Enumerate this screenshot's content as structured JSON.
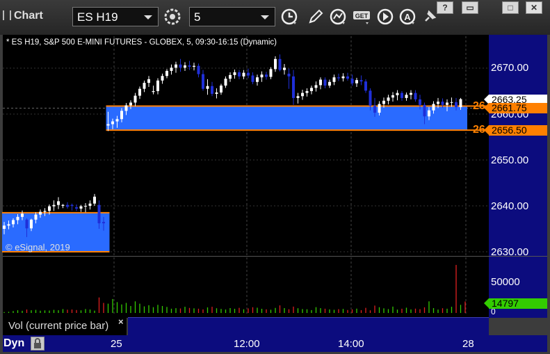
{
  "app": {
    "title": "Chart",
    "symbol": "ES H19",
    "interval": "5",
    "dyn_label": "Dyn"
  },
  "toolbar_icons": [
    "settings-icon",
    "clock-icon",
    "pencil-icon",
    "chart-type-icon",
    "get-icon",
    "play-icon",
    "a-icon",
    "pin-icon"
  ],
  "window_buttons": [
    "?",
    "▭",
    "□",
    "✕"
  ],
  "chart": {
    "description": "* ES H19, S&P 500 E-MINI FUTURES - GLOBEX, 5, 09:30-16:15 (Dynamic)",
    "copyright": "© eSignal, 2019",
    "price_ticks": [
      "2670.00",
      "2660.00",
      "2650.00",
      "2640.00",
      "2630.00"
    ],
    "last_price": "2663.25",
    "high_tag": "2661.75",
    "low_tag": "2656.50",
    "orange_label_1": "26",
    "orange_label_2": "26",
    "time_ticks": [
      "25",
      "12:00",
      "14:00",
      "28"
    ]
  },
  "volume": {
    "legend": "Vol (current price bar)",
    "close": "×",
    "ticks": [
      "50000",
      "0"
    ],
    "last": "14797"
  },
  "colors": {
    "background": "#000000",
    "scale": "#0c0c7e",
    "band": "#2a6bff",
    "orange": "#ff8000",
    "bull": "#ffffff",
    "bear": "#1f2fd8"
  },
  "chart_data": {
    "type": "candlestick",
    "ylim": [
      2628,
      2675
    ],
    "bands": [
      {
        "from_bar": 0,
        "to_bar": 23,
        "high": 2638.5,
        "low": 2630.0
      },
      {
        "from_bar": 23,
        "to_bar": 102,
        "high": 2661.75,
        "low": 2656.5
      }
    ],
    "candles": [
      [
        2635.0,
        2636.5,
        2633.8,
        2635.7
      ],
      [
        2635.7,
        2636.8,
        2634.9,
        2636.0
      ],
      [
        2636.0,
        2637.3,
        2635.3,
        2636.9
      ],
      [
        2636.9,
        2638.2,
        2636.0,
        2637.6
      ],
      [
        2637.6,
        2639.0,
        2636.9,
        2638.3
      ],
      [
        2637.0,
        2637.3,
        2633.2,
        2635.1
      ],
      [
        2635.1,
        2637.2,
        2634.5,
        2637.0
      ],
      [
        2637.0,
        2638.6,
        2636.2,
        2638.1
      ],
      [
        2638.1,
        2639.2,
        2637.4,
        2638.7
      ],
      [
        2638.7,
        2639.5,
        2637.8,
        2638.9
      ],
      [
        2638.9,
        2640.3,
        2638.1,
        2639.9
      ],
      [
        2639.9,
        2641.2,
        2638.9,
        2640.2
      ],
      [
        2640.2,
        2641.9,
        2639.3,
        2641.0
      ],
      [
        2640.0,
        2640.4,
        2639.5,
        2640.2
      ],
      [
        2640.2,
        2640.8,
        2639.4,
        2639.8
      ],
      [
        2640.2,
        2640.5,
        2639.0,
        2640.0
      ],
      [
        2639.7,
        2640.3,
        2638.9,
        2639.4
      ],
      [
        2639.4,
        2640.2,
        2638.7,
        2639.9
      ],
      [
        2639.9,
        2640.6,
        2638.6,
        2640.0
      ],
      [
        2640.0,
        2641.2,
        2639.2,
        2640.5
      ],
      [
        2640.5,
        2642.6,
        2640.0,
        2642.0
      ],
      [
        2640.2,
        2641.2,
        2635.0,
        2636.2
      ],
      [
        2636.5,
        2637.6,
        2634.6,
        2636.2
      ],
      [
        2657.5,
        2660.5,
        2656.3,
        2657.8
      ],
      [
        2657.8,
        2659.0,
        2656.7,
        2658.4
      ],
      [
        2658.4,
        2659.6,
        2657.0,
        2658.9
      ],
      [
        2658.9,
        2661.3,
        2658.2,
        2660.7
      ],
      [
        2660.7,
        2662.4,
        2659.8,
        2661.9
      ],
      [
        2661.9,
        2663.0,
        2661.1,
        2662.5
      ],
      [
        2662.5,
        2664.6,
        2661.7,
        2664.0
      ],
      [
        2664.0,
        2666.0,
        2663.3,
        2665.5
      ],
      [
        2665.5,
        2667.3,
        2664.8,
        2666.8
      ],
      [
        2666.8,
        2668.3,
        2665.9,
        2667.6
      ],
      [
        2664.8,
        2666.2,
        2664.3,
        2665.0
      ],
      [
        2665.0,
        2667.8,
        2664.3,
        2667.3
      ],
      [
        2667.3,
        2668.8,
        2666.6,
        2668.3
      ],
      [
        2668.3,
        2669.8,
        2667.8,
        2669.4
      ],
      [
        2669.4,
        2670.8,
        2668.6,
        2670.1
      ],
      [
        2670.1,
        2671.4,
        2669.0,
        2670.8
      ],
      [
        2670.8,
        2672.0,
        2669.2,
        2670.1
      ],
      [
        2670.1,
        2671.3,
        2669.4,
        2670.6
      ],
      [
        2670.6,
        2671.6,
        2669.6,
        2670.3
      ],
      [
        2670.3,
        2671.2,
        2669.5,
        2670.5
      ],
      [
        2670.5,
        2671.0,
        2668.0,
        2668.7
      ],
      [
        2668.7,
        2669.6,
        2665.1,
        2665.5
      ],
      [
        2665.5,
        2667.6,
        2664.2,
        2666.1
      ],
      [
        2666.1,
        2667.0,
        2663.9,
        2664.4
      ],
      [
        2664.4,
        2665.6,
        2663.4,
        2664.7
      ],
      [
        2664.7,
        2666.6,
        2664.2,
        2666.2
      ],
      [
        2666.2,
        2668.2,
        2665.7,
        2667.7
      ],
      [
        2667.7,
        2669.1,
        2667.0,
        2668.5
      ],
      [
        2668.5,
        2669.7,
        2667.7,
        2669.1
      ],
      [
        2669.1,
        2669.6,
        2667.6,
        2668.2
      ],
      [
        2668.2,
        2669.6,
        2667.6,
        2669.0
      ],
      [
        2669.0,
        2669.9,
        2667.8,
        2668.4
      ],
      [
        2668.4,
        2669.1,
        2666.5,
        2667.0
      ],
      [
        2667.0,
        2668.6,
        2666.2,
        2668.0
      ],
      [
        2668.0,
        2669.3,
        2667.0,
        2668.6
      ],
      [
        2668.6,
        2669.2,
        2667.5,
        2668.1
      ],
      [
        2668.1,
        2670.2,
        2667.6,
        2669.8
      ],
      [
        2669.8,
        2672.6,
        2669.2,
        2672.0
      ],
      [
        2672.0,
        2673.0,
        2669.3,
        2669.6
      ],
      [
        2669.6,
        2670.9,
        2668.6,
        2670.1
      ],
      [
        2668.8,
        2669.9,
        2665.5,
        2668.2
      ],
      [
        2668.2,
        2669.6,
        2662.0,
        2663.5
      ],
      [
        2663.5,
        2664.6,
        2662.3,
        2663.9
      ],
      [
        2663.9,
        2665.3,
        2663.1,
        2664.6
      ],
      [
        2664.6,
        2665.6,
        2663.8,
        2665.0
      ],
      [
        2665.0,
        2666.2,
        2664.3,
        2665.7
      ],
      [
        2665.7,
        2667.1,
        2664.9,
        2666.3
      ],
      [
        2666.3,
        2668.0,
        2665.4,
        2667.5
      ],
      [
        2667.5,
        2668.0,
        2665.6,
        2666.2
      ],
      [
        2666.2,
        2667.5,
        2665.7,
        2667.0
      ],
      [
        2667.0,
        2668.6,
        2666.3,
        2668.0
      ],
      [
        2668.0,
        2668.8,
        2667.2,
        2667.8
      ],
      [
        2667.8,
        2668.9,
        2667.1,
        2668.2
      ],
      [
        2668.2,
        2669.0,
        2667.3,
        2667.7
      ],
      [
        2667.7,
        2668.6,
        2666.2,
        2666.7
      ],
      [
        2666.7,
        2667.9,
        2665.9,
        2667.4
      ],
      [
        2667.4,
        2668.4,
        2666.3,
        2667.1
      ],
      [
        2667.1,
        2667.6,
        2664.6,
        2665.1
      ],
      [
        2665.1,
        2665.6,
        2660.8,
        2661.8
      ],
      [
        2661.8,
        2663.5,
        2659.4,
        2660.3
      ],
      [
        2660.3,
        2662.8,
        2659.7,
        2662.2
      ],
      [
        2662.2,
        2663.6,
        2661.4,
        2662.9
      ],
      [
        2662.9,
        2664.2,
        2662.1,
        2663.6
      ],
      [
        2663.6,
        2664.8,
        2662.7,
        2664.1
      ],
      [
        2664.1,
        2665.2,
        2663.0,
        2664.6
      ],
      [
        2664.6,
        2665.0,
        2662.9,
        2663.5
      ],
      [
        2663.5,
        2664.7,
        2662.9,
        2664.2
      ],
      [
        2664.2,
        2665.2,
        2663.2,
        2664.6
      ],
      [
        2664.6,
        2665.2,
        2662.7,
        2663.2
      ],
      [
        2663.2,
        2664.2,
        2661.0,
        2662.0
      ],
      [
        2662.0,
        2662.5,
        2657.8,
        2659.5
      ],
      [
        2659.5,
        2661.5,
        2658.7,
        2660.8
      ],
      [
        2660.8,
        2662.8,
        2660.1,
        2662.2
      ],
      [
        2662.2,
        2663.5,
        2661.3,
        2662.7
      ],
      [
        2662.7,
        2663.4,
        2661.4,
        2662.0
      ],
      [
        2662.0,
        2663.2,
        2660.6,
        2662.5
      ],
      [
        2662.5,
        2663.6,
        2661.6,
        2662.6
      ],
      [
        2662.6,
        2663.5,
        2660.8,
        2661.5
      ],
      [
        2661.5,
        2663.5,
        2660.9,
        2663.25
      ]
    ],
    "volume_ylim": [
      0,
      70000
    ],
    "volume": [
      1200,
      1500,
      2500,
      3500,
      2800,
      4500,
      3500,
      4000,
      2900,
      3300,
      3100,
      4000,
      3500,
      5000,
      4200,
      4500,
      3800,
      3400,
      5000,
      4500,
      3000,
      20000,
      13000,
      12000,
      18000,
      14000,
      11000,
      13000,
      9000,
      15000,
      12000,
      8500,
      10000,
      7500,
      10500,
      9000,
      7800,
      5500,
      6200,
      5800,
      8000,
      6500,
      6000,
      5500,
      4600,
      7200,
      8000,
      6100,
      5200,
      4500,
      6300,
      5400,
      6600,
      4800,
      5900,
      7400,
      6800,
      5400,
      4700,
      4200,
      6500,
      9800,
      6300,
      4800,
      8200,
      6100,
      5000,
      4800,
      3700,
      7500,
      6200,
      5500,
      4600,
      4100,
      4900,
      5200,
      3800,
      4700,
      5600,
      3600,
      6600,
      3400,
      9500,
      7400,
      6000,
      5000,
      8200,
      4400,
      5500,
      6800,
      4600,
      5600,
      4900,
      7300,
      15000,
      6300,
      4400,
      6100,
      5500,
      8000,
      62000,
      10500,
      14797
    ]
  }
}
